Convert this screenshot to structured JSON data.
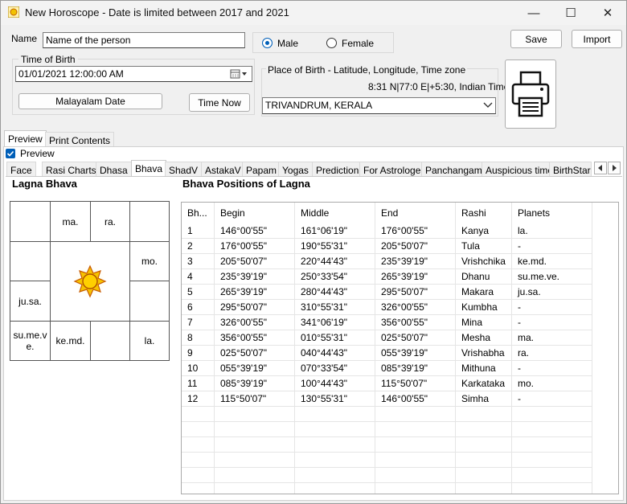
{
  "window": {
    "title": "New Horoscope - Date is limited between 2017 and 2021",
    "minimize_glyph": "—",
    "maximize_glyph": "☐",
    "close_glyph": "✕"
  },
  "form": {
    "name_label": "Name",
    "name_value": "Name of the person",
    "gender": {
      "male": "Male",
      "female": "Female",
      "selected": "Male"
    },
    "save_label": "Save",
    "import_label": "Import",
    "time_of_birth_label": "Time of Birth",
    "datetime_value": "01/01/2021  12:00:00 AM",
    "malayalam_date_label": "Malayalam Date",
    "time_now_label": "Time Now",
    "place_label": "Place of Birth - Latitude, Longitude, Time zone",
    "place_coords": "8:31 N|77:0 E|+5:30, Indian Time",
    "place_value": "TRIVANDRUM, KERALA"
  },
  "outer_tabs": [
    {
      "label": "Preview",
      "selected": true
    },
    {
      "label": "Print Contents",
      "selected": false
    }
  ],
  "preview_checkbox": {
    "label": "Preview",
    "checked": true
  },
  "inner_tabs": [
    "Face",
    "Rasi Charts",
    "Dhasa",
    "Bhava",
    "ShadV",
    "AstakaV",
    "Papam",
    "Yogas",
    "Prediction",
    "For Astrologer",
    "Panchangam",
    "Auspicious time",
    "BirthStar"
  ],
  "inner_tabs_selected": "Bhava",
  "lagna_bhava": {
    "title": "Lagna Bhava",
    "cells": {
      "r1c2": "ma.",
      "r1c3": "ra.",
      "r2c4": "mo.",
      "r3c1": "ju.sa.",
      "r4c1": "su.me.ve.",
      "r4c2": "ke.md.",
      "r4c4": "la."
    }
  },
  "bhava_positions": {
    "title": "Bhava Positions of Lagna",
    "columns": [
      "Bh...",
      "Begin",
      "Middle",
      "End",
      "Rashi",
      "Planets"
    ],
    "rows": [
      [
        "1",
        "146°00'55\"",
        "161°06'19\"",
        "176°00'55\"",
        "Kanya",
        "la."
      ],
      [
        "2",
        "176°00'55\"",
        "190°55'31\"",
        "205°50'07\"",
        "Tula",
        "-"
      ],
      [
        "3",
        "205°50'07\"",
        "220°44'43\"",
        "235°39'19\"",
        "Vrishchika",
        "ke.md."
      ],
      [
        "4",
        "235°39'19\"",
        "250°33'54\"",
        "265°39'19\"",
        "Dhanu",
        "su.me.ve."
      ],
      [
        "5",
        "265°39'19\"",
        "280°44'43\"",
        "295°50'07\"",
        "Makara",
        "ju.sa."
      ],
      [
        "6",
        "295°50'07\"",
        "310°55'31\"",
        "326°00'55\"",
        "Kumbha",
        "-"
      ],
      [
        "7",
        "326°00'55\"",
        "341°06'19\"",
        "356°00'55\"",
        "Mina",
        "-"
      ],
      [
        "8",
        "356°00'55\"",
        "010°55'31\"",
        "025°50'07\"",
        "Mesha",
        "ma."
      ],
      [
        "9",
        "025°50'07\"",
        "040°44'43\"",
        "055°39'19\"",
        "Vrishabha",
        "ra."
      ],
      [
        "10",
        "055°39'19\"",
        "070°33'54\"",
        "085°39'19\"",
        "Mithuna",
        "-"
      ],
      [
        "11",
        "085°39'19\"",
        "100°44'43\"",
        "115°50'07\"",
        "Karkataka",
        "mo."
      ],
      [
        "12",
        "115°50'07\"",
        "130°55'31\"",
        "146°00'55\"",
        "Simha",
        "-"
      ]
    ]
  },
  "colors": {
    "accent": "#005fb8",
    "sun_yellow": "#f2c200",
    "sun_orange": "#e07a10"
  }
}
